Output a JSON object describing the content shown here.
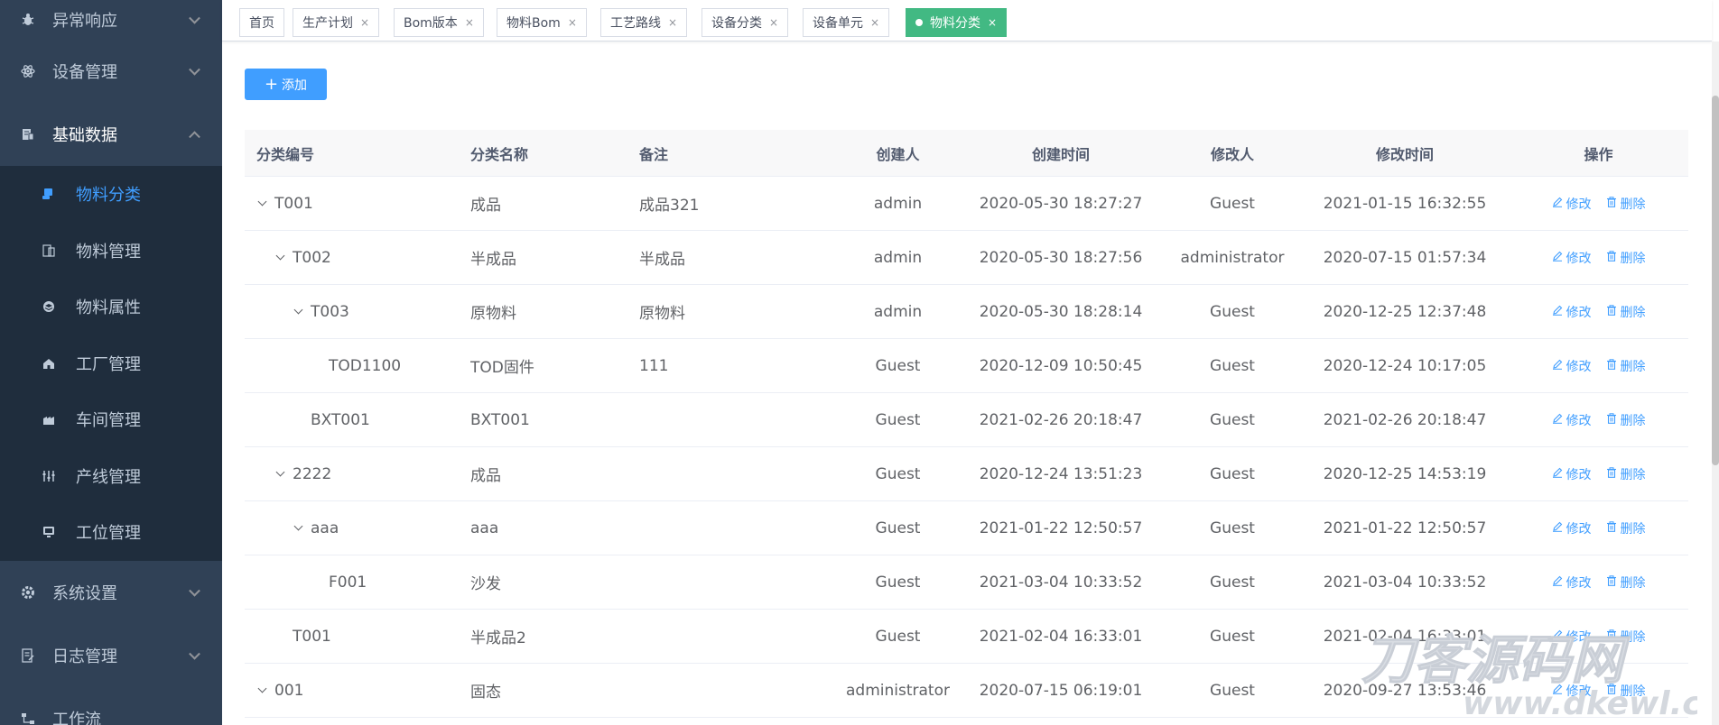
{
  "sidebar": {
    "menu_top": [
      {
        "label": "异常响应",
        "icon": "bug-icon"
      },
      {
        "label": "设备管理",
        "icon": "atom-icon"
      },
      {
        "label": "基础数据",
        "icon": "database-icon"
      }
    ],
    "submenu": [
      {
        "label": "物料分类",
        "icon": "material-category-icon",
        "active": true
      },
      {
        "label": "物料管理",
        "icon": "material-manage-icon"
      },
      {
        "label": "物料属性",
        "icon": "material-attribute-icon"
      },
      {
        "label": "工厂管理",
        "icon": "factory-icon"
      },
      {
        "label": "车间管理",
        "icon": "workshop-icon"
      },
      {
        "label": "产线管理",
        "icon": "production-line-icon"
      },
      {
        "label": "工位管理",
        "icon": "workstation-icon"
      }
    ],
    "menu_bottom": [
      {
        "label": "系统设置",
        "icon": "gear-icon"
      },
      {
        "label": "日志管理",
        "icon": "log-icon"
      },
      {
        "label": "工作流",
        "icon": "workflow-icon"
      }
    ]
  },
  "tabs": [
    {
      "label": "首页",
      "closable": false
    },
    {
      "label": "生产计划",
      "closable": true
    },
    {
      "label": "Bom版本",
      "closable": true
    },
    {
      "label": "物料Bom",
      "closable": true
    },
    {
      "label": "工艺路线",
      "closable": true
    },
    {
      "label": "设备分类",
      "closable": true
    },
    {
      "label": "设备单元",
      "closable": true
    },
    {
      "label": "物料分类",
      "closable": true,
      "active": true
    }
  ],
  "tab_close_glyph": "×",
  "toolbar": {
    "add_label": "添加"
  },
  "table": {
    "headers": [
      "分类编号",
      "分类名称",
      "备注",
      "创建人",
      "创建时间",
      "修改人",
      "修改时间",
      "操作"
    ],
    "edit_label": "修改",
    "delete_label": "删除",
    "rows": [
      {
        "code": "T001",
        "name": "成品",
        "remark": "成品321",
        "creator": "admin",
        "created": "2020-05-30 18:27:27",
        "modifier": "Guest",
        "modified": "2021-01-15 16:32:55",
        "level": 0,
        "expandable": true
      },
      {
        "code": "T002",
        "name": "半成品",
        "remark": "半成品",
        "creator": "admin",
        "created": "2020-05-30 18:27:56",
        "modifier": "administrator",
        "modified": "2020-07-15 01:57:34",
        "level": 1,
        "expandable": true
      },
      {
        "code": "T003",
        "name": "原物料",
        "remark": "原物料",
        "creator": "admin",
        "created": "2020-05-30 18:28:14",
        "modifier": "Guest",
        "modified": "2020-12-25 12:37:48",
        "level": 2,
        "expandable": true
      },
      {
        "code": "TOD1100",
        "name": "TOD固件",
        "remark": "111",
        "creator": "Guest",
        "created": "2020-12-09 10:50:45",
        "modifier": "Guest",
        "modified": "2020-12-24 10:17:05",
        "level": 3,
        "expandable": false
      },
      {
        "code": "BXT001",
        "name": "BXT001",
        "remark": "",
        "creator": "Guest",
        "created": "2021-02-26 20:18:47",
        "modifier": "Guest",
        "modified": "2021-02-26 20:18:47",
        "level": 2,
        "expandable": false
      },
      {
        "code": "2222",
        "name": "成品",
        "remark": "",
        "creator": "Guest",
        "created": "2020-12-24 13:51:23",
        "modifier": "Guest",
        "modified": "2020-12-25 14:53:19",
        "level": 1,
        "expandable": true
      },
      {
        "code": "aaa",
        "name": "aaa",
        "remark": "",
        "creator": "Guest",
        "created": "2021-01-22 12:50:57",
        "modifier": "Guest",
        "modified": "2021-01-22 12:50:57",
        "level": 2,
        "expandable": true
      },
      {
        "code": "F001",
        "name": "沙发",
        "remark": "",
        "creator": "Guest",
        "created": "2021-03-04 10:33:52",
        "modifier": "Guest",
        "modified": "2021-03-04 10:33:52",
        "level": 3,
        "expandable": false
      },
      {
        "code": "T001",
        "name": "半成品2",
        "remark": "",
        "creator": "Guest",
        "created": "2021-02-04 16:33:01",
        "modifier": "Guest",
        "modified": "2021-02-04 16:33:01",
        "level": 1,
        "expandable": false
      },
      {
        "code": "001",
        "name": "固态",
        "remark": "",
        "creator": "administrator",
        "created": "2020-07-15 06:19:01",
        "modifier": "Guest",
        "modified": "2020-09-27 13:53:46",
        "level": 0,
        "expandable": true
      }
    ]
  },
  "watermark": {
    "main": "刀客源码网",
    "sub": "www.dkewl.com"
  },
  "colors": {
    "sidebar_bg": "#304156",
    "submenu_bg": "#1f2d3d",
    "primary": "#409eff",
    "active_tab": "#42b983"
  }
}
